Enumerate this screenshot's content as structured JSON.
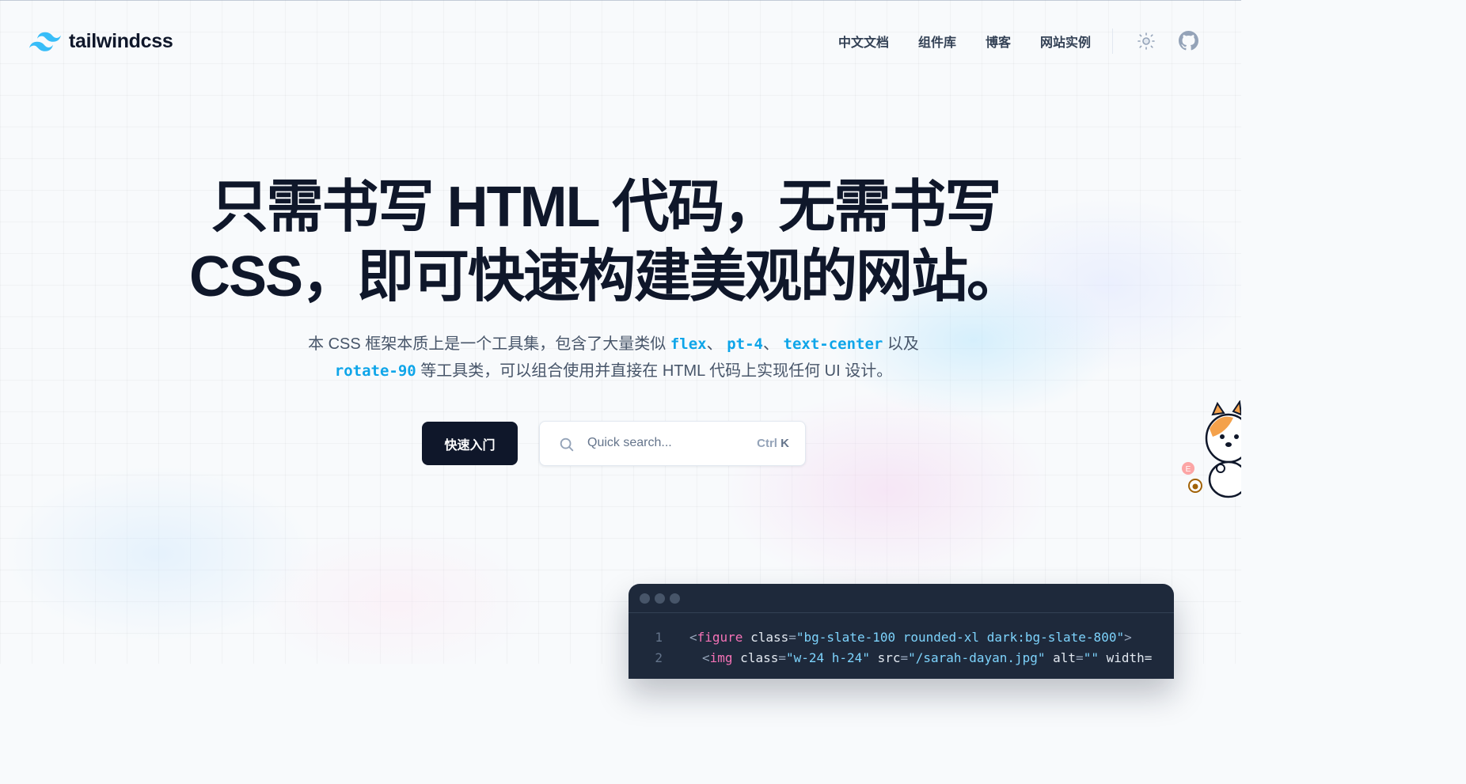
{
  "logo": {
    "text": "tailwindcss",
    "icon": "tailwind-logo-icon",
    "color": "#38bdf8"
  },
  "nav": [
    {
      "label": "中文文档"
    },
    {
      "label": "组件库"
    },
    {
      "label": "博客"
    },
    {
      "label": "网站实例"
    }
  ],
  "header_icons": {
    "theme": "sun-icon",
    "github": "github-icon"
  },
  "hero": {
    "title_line1": "只需书写 HTML 代码，无需书写",
    "title_line2": "CSS，即可快速构建美观的网站。",
    "sub_a": "本 CSS 框架本质上是一个工具集，包含了大量类似 ",
    "code_flex": "flex",
    "sep1": "、 ",
    "code_pt4": "pt-4",
    "sep2": "、 ",
    "code_text_center": "text-center",
    "sub_b": " 以及",
    "code_rotate": "rotate-90",
    "sub_c": " 等工具类，可以组合使用并直接在 HTML 代码上实现任何 UI 设计。"
  },
  "cta": {
    "start_label": "快速入门"
  },
  "search": {
    "placeholder": "Quick search...",
    "shortcut_mod": "Ctrl",
    "shortcut_key": "K"
  },
  "code_window": {
    "lines": [
      {
        "num": "1",
        "open": "<",
        "tag": "figure",
        "attr": " class",
        "eq": "=",
        "str": "\"bg-slate-100 rounded-xl dark:bg-slate-800\"",
        "close": ">"
      },
      {
        "num": "2",
        "open": "<",
        "tag": "img",
        "attr1": " class",
        "str1": "\"w-24 h-24\"",
        "attr2": " src",
        "str2": "\"/sarah-dayan.jpg\"",
        "attr3": " alt",
        "str3": "\"\"",
        "attr4": " width="
      }
    ]
  },
  "colors": {
    "brand_dark": "#0f172a",
    "accent": "#0ea5e9",
    "code_bg": "#1e293b"
  }
}
